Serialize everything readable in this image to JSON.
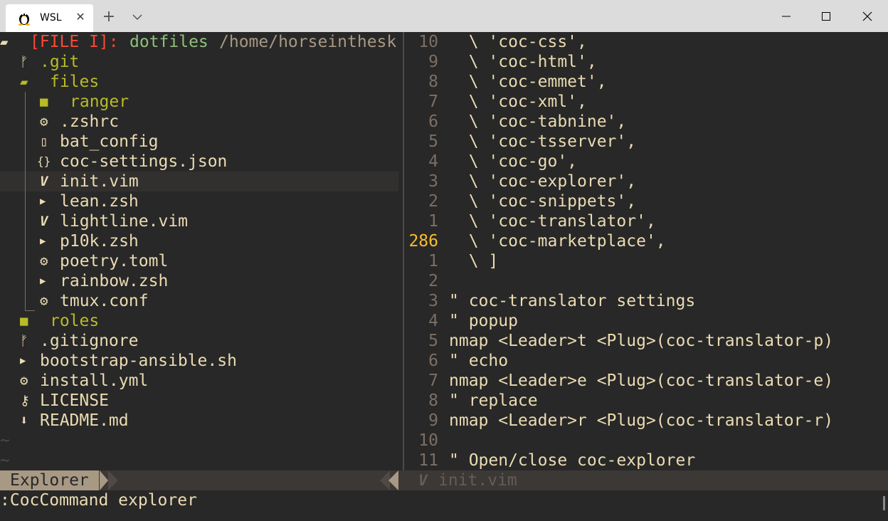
{
  "window": {
    "tab_title": "WSL",
    "tab_close_glyph": "✕",
    "new_tab_glyph": "+",
    "minimize_glyph": "—",
    "maximize_glyph": "☐",
    "close_glyph": "✕"
  },
  "explorer": {
    "header_tag": "[FILE I]:",
    "header_root": "dotfiles",
    "header_path": "/home/horseinthesk",
    "items": [
      {
        "name": ".git",
        "icon": "git-icon",
        "glyph": "ᚠ"
      },
      {
        "name": "files",
        "icon": "folder-open-icon",
        "glyph": "▰"
      },
      {
        "name": "ranger",
        "icon": "folder-icon",
        "glyph": "■"
      },
      {
        "name": ".zshrc",
        "icon": "gear-icon",
        "glyph": "⚙"
      },
      {
        "name": "bat_config",
        "icon": "file-icon",
        "glyph": "▯"
      },
      {
        "name": "coc-settings.json",
        "icon": "json-icon",
        "glyph": "{}"
      },
      {
        "name": "init.vim",
        "icon": "vim-icon",
        "glyph": "V"
      },
      {
        "name": "lean.zsh",
        "icon": "terminal-icon",
        "glyph": "▶"
      },
      {
        "name": "lightline.vim",
        "icon": "vim-icon",
        "glyph": "V"
      },
      {
        "name": "p10k.zsh",
        "icon": "terminal-icon",
        "glyph": "▶"
      },
      {
        "name": "poetry.toml",
        "icon": "gear-icon",
        "glyph": "⚙"
      },
      {
        "name": "rainbow.zsh",
        "icon": "terminal-icon",
        "glyph": "▶"
      },
      {
        "name": "tmux.conf",
        "icon": "gear-icon",
        "glyph": "⚙"
      },
      {
        "name": "roles",
        "icon": "folder-icon",
        "glyph": "■"
      },
      {
        "name": ".gitignore",
        "icon": "git-icon",
        "glyph": "ᚠ"
      },
      {
        "name": "bootstrap-ansible.sh",
        "icon": "terminal-icon",
        "glyph": "▶"
      },
      {
        "name": "install.yml",
        "icon": "gear-icon",
        "glyph": "⚙"
      },
      {
        "name": "LICENSE",
        "icon": "license-icon",
        "glyph": "⚷"
      },
      {
        "name": "README.md",
        "icon": "markdown-icon",
        "glyph": "⬇"
      }
    ],
    "tilde": "~"
  },
  "editor": {
    "lines": [
      {
        "num": "10",
        "text": "  \\ 'coc-css',"
      },
      {
        "num": "9",
        "text": "  \\ 'coc-html',"
      },
      {
        "num": "8",
        "text": "  \\ 'coc-emmet',"
      },
      {
        "num": "7",
        "text": "  \\ 'coc-xml',"
      },
      {
        "num": "6",
        "text": "  \\ 'coc-tabnine',"
      },
      {
        "num": "5",
        "text": "  \\ 'coc-tsserver',"
      },
      {
        "num": "4",
        "text": "  \\ 'coc-go',"
      },
      {
        "num": "3",
        "text": "  \\ 'coc-explorer',"
      },
      {
        "num": "2",
        "text": "  \\ 'coc-snippets',"
      },
      {
        "num": "1",
        "text": "  \\ 'coc-translator',"
      },
      {
        "num": "286",
        "text": "  \\ 'coc-marketplace',"
      },
      {
        "num": "1",
        "text": "  \\ ]"
      },
      {
        "num": "2",
        "text": ""
      },
      {
        "num": "3",
        "text": "\" coc-translator settings"
      },
      {
        "num": "4",
        "text": "\" popup"
      },
      {
        "num": "5",
        "text": "nmap <Leader>t <Plug>(coc-translator-p)"
      },
      {
        "num": "6",
        "text": "\" echo"
      },
      {
        "num": "7",
        "text": "nmap <Leader>e <Plug>(coc-translator-e)"
      },
      {
        "num": "8",
        "text": "\" replace"
      },
      {
        "num": "9",
        "text": "nmap <Leader>r <Plug>(coc-translator-r)"
      },
      {
        "num": "10",
        "text": ""
      },
      {
        "num": "11",
        "text": "\" Open/close coc-explorer"
      }
    ]
  },
  "statusline": {
    "mode": "Explorer",
    "file_icon_glyph": "V",
    "file": "init.vim"
  },
  "cmdline": ":CocCommand explorer",
  "colors": {
    "bg": "#282828",
    "fg": "#ebdbb2",
    "folder": "#b8bb26",
    "header_tag": "#fb4934",
    "header_root": "#8ec07c",
    "current_line_number": "#fabd2f",
    "line_number": "#7c6f64"
  }
}
